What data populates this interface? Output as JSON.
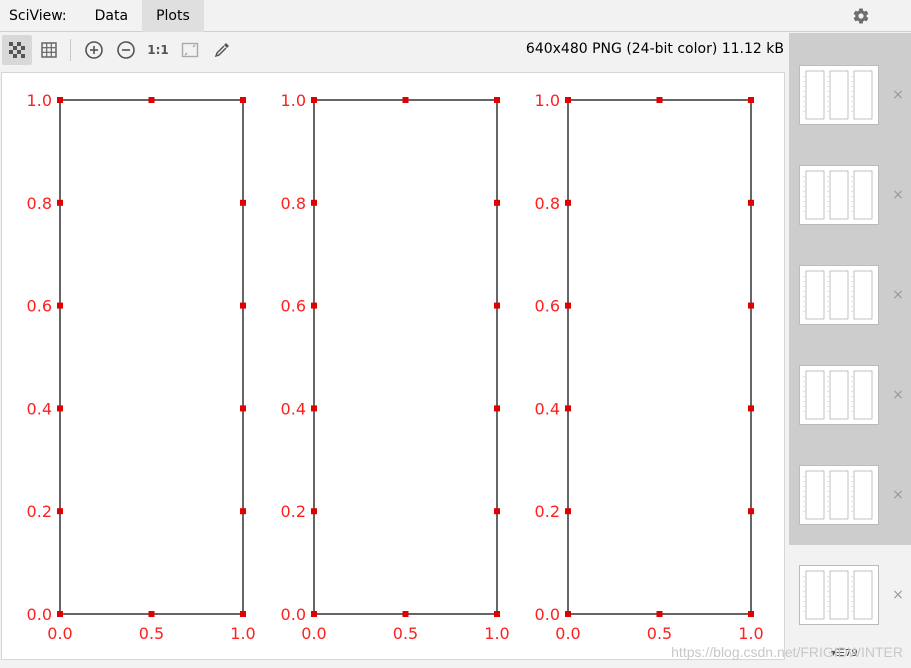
{
  "header": {
    "tool_title": "SciView:",
    "tabs": [
      {
        "label": "Data",
        "active": false
      },
      {
        "label": "Plots",
        "active": true
      }
    ]
  },
  "toolbar": {
    "image_info": "640x480 PNG (24-bit color) 11.12 kB",
    "zoom_actual_label": "1:1",
    "icons": [
      "chessboard-icon",
      "grid-icon",
      "zoom-in-icon",
      "zoom-out-icon",
      "actual-size-icon",
      "fit-icon",
      "color-picker-icon"
    ]
  },
  "colors": {
    "axis_red": "#ff2020",
    "marker_red": "#e00000",
    "frame": "#000000"
  },
  "chart_data": [
    {
      "type": "scatter",
      "x_ticks": [
        "0.0",
        "0.5",
        "1.0"
      ],
      "y_ticks": [
        "0.0",
        "0.2",
        "0.4",
        "0.6",
        "0.8",
        "1.0"
      ],
      "xlim": [
        0,
        1
      ],
      "ylim": [
        0,
        1
      ]
    },
    {
      "type": "scatter",
      "x_ticks": [
        "0.0",
        "0.5",
        "1.0"
      ],
      "y_ticks": [
        "0.0",
        "0.2",
        "0.4",
        "0.6",
        "0.8",
        "1.0"
      ],
      "xlim": [
        0,
        1
      ],
      "ylim": [
        0,
        1
      ]
    },
    {
      "type": "scatter",
      "x_ticks": [
        "0.0",
        "0.5",
        "1.0"
      ],
      "y_ticks": [
        "0.0",
        "0.2",
        "0.4",
        "0.6",
        "0.8",
        "1.0"
      ],
      "xlim": [
        0,
        1
      ],
      "ylim": [
        0,
        1
      ]
    }
  ],
  "sidebar": {
    "thumbnail_count": 6,
    "history_count": "79",
    "close_glyph": "×"
  },
  "watermark": "https://blog.csdn.net/FRIGIDWINTER"
}
